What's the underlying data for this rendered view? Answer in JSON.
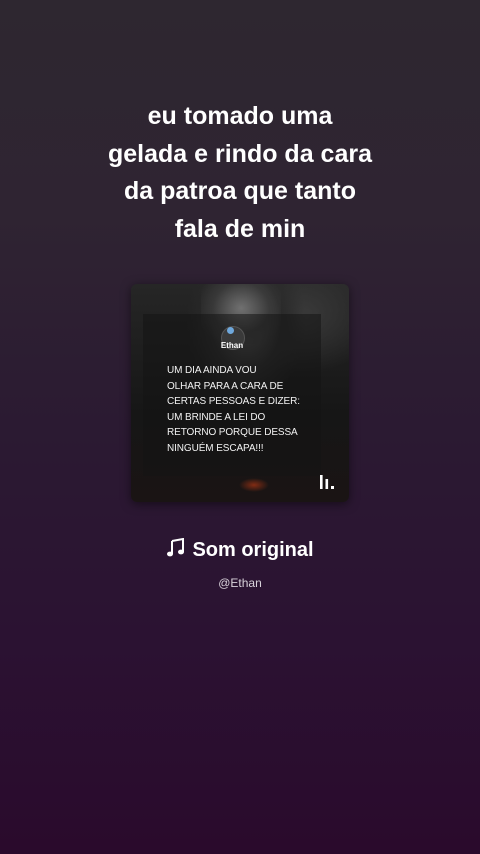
{
  "caption": {
    "lines": [
      "eu tomado uma",
      "gelada e rindo da cara",
      "da patroa que tanto",
      "fala de min"
    ]
  },
  "cover": {
    "post_author": "Ethan",
    "post_lines": [
      "UM DIA AINDA VOU",
      "OLHAR PARA A CARA DE",
      "CERTAS PESSOAS E DIZER:",
      "UM BRINDE A LEI DO",
      "RETORNO PORQUE DESSA",
      "NINGUÉM ESCAPA!!!"
    ],
    "logo_icon": "capcut-logo-icon"
  },
  "audio": {
    "icon": "music-note-icon",
    "title": "Som original",
    "handle": "@Ethan"
  }
}
